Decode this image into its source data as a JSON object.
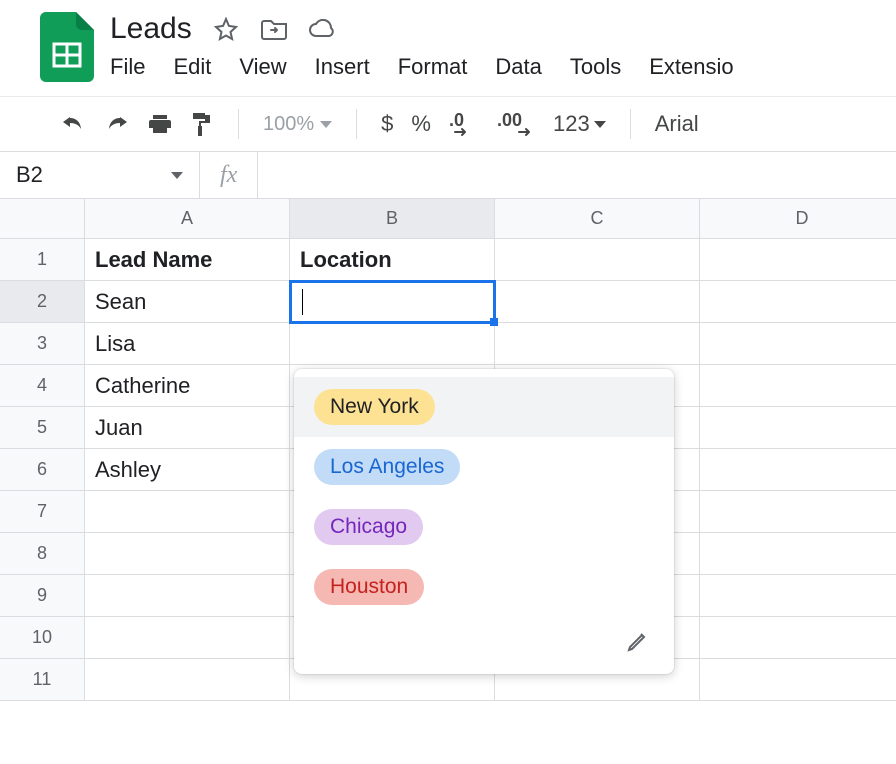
{
  "doc": {
    "title": "Leads"
  },
  "menu": {
    "file": "File",
    "edit": "Edit",
    "view": "View",
    "insert": "Insert",
    "format": "Format",
    "data": "Data",
    "tools": "Tools",
    "extensions": "Extensio"
  },
  "toolbar": {
    "zoom": "100%",
    "d0_icon": ".0",
    "d00_icon": ".00",
    "numfmt": "123",
    "font": "Arial"
  },
  "namebox": {
    "cell_ref": "B2"
  },
  "headers": {
    "colA": "A",
    "colB": "B",
    "colC": "C",
    "colD": "D"
  },
  "rows": [
    "1",
    "2",
    "3",
    "4",
    "5",
    "6",
    "7",
    "8",
    "9",
    "10",
    "11"
  ],
  "table": {
    "header": {
      "lead_name": "Lead Name",
      "location": "Location"
    },
    "leads": {
      "r2": "Sean",
      "r3": "Lisa",
      "r4": "Catherine",
      "r5": "Juan",
      "r6": "Ashley"
    }
  },
  "dropdown": {
    "opt1": {
      "label": "New York",
      "bg": "#fde293",
      "fg": "#202124"
    },
    "opt2": {
      "label": "Los Angeles",
      "bg": "#c2dbf7",
      "fg": "#1967d2"
    },
    "opt3": {
      "label": "Chicago",
      "bg": "#e1c9f0",
      "fg": "#7627bb"
    },
    "opt4": {
      "label": "Houston",
      "bg": "#f5b8b3",
      "fg": "#c5221f"
    }
  }
}
